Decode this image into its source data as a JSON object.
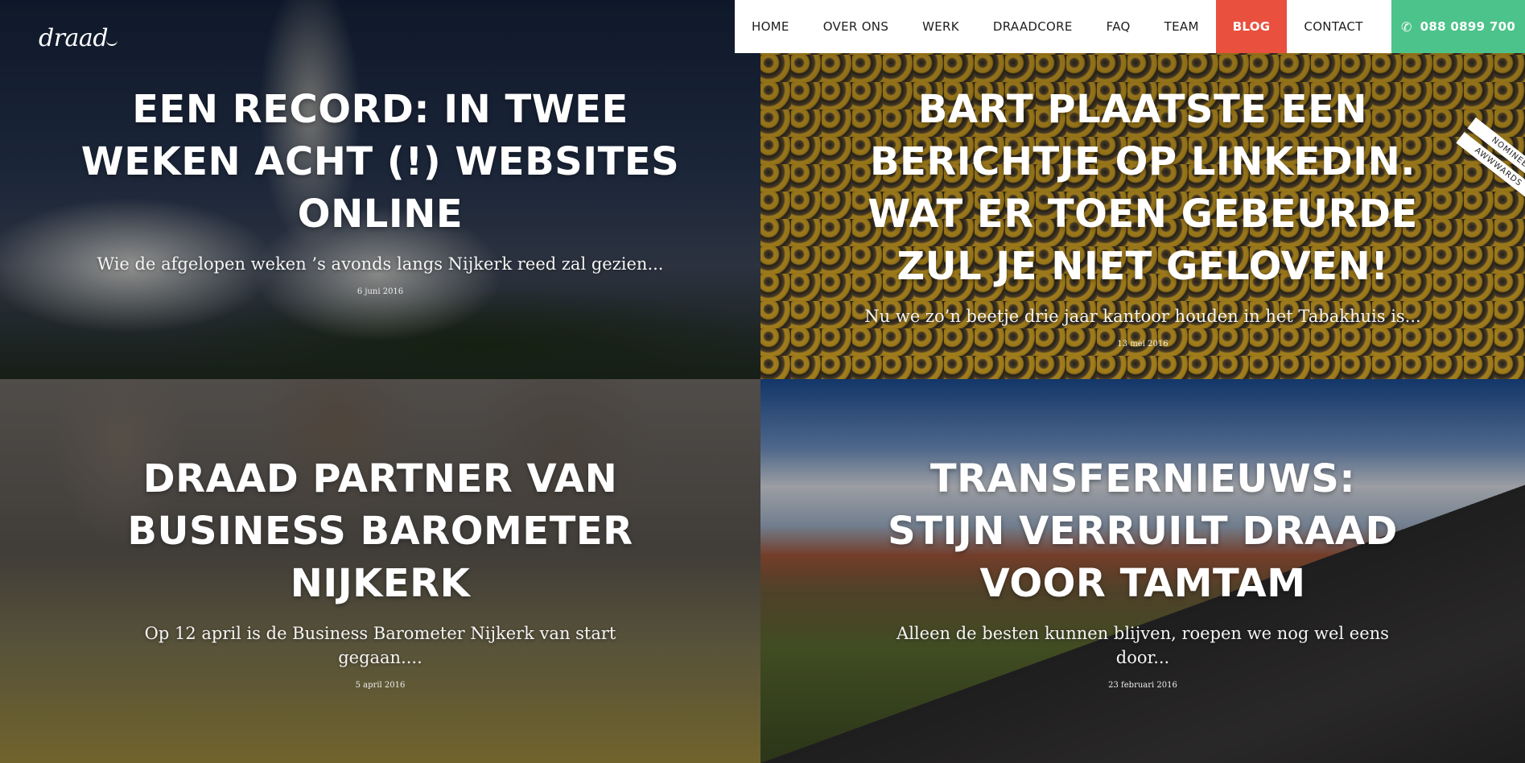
{
  "header": {
    "logo_text": "draad"
  },
  "nav": {
    "items": [
      {
        "label": "HOME"
      },
      {
        "label": "OVER ONS"
      },
      {
        "label": "WERK"
      },
      {
        "label": "DRAADCORE"
      },
      {
        "label": "FAQ"
      },
      {
        "label": "TEAM"
      },
      {
        "label": "BLOG",
        "active": true
      },
      {
        "label": "CONTACT"
      }
    ],
    "phone": {
      "icon": "phone-icon",
      "label": "088 0899 700"
    },
    "colors": {
      "active": "#e9503e",
      "phone": "#4cc38a"
    }
  },
  "ribbon": {
    "top": "NOMINEE",
    "bottom": "AWWWARDS"
  },
  "posts": [
    {
      "title": "EEN RECORD: IN TWEE WEKEN ACHT (!) WEBSITES ONLINE",
      "excerpt": "Wie de afgelopen weken ’s avonds langs Nijkerk reed zal gezien...",
      "date": "6 juni 2016"
    },
    {
      "title": "BART PLAATSTE EEN BERICHTJE OP LINKEDIN. WAT ER TOEN GEBEURDE ZUL JE NIET GELOVEN!",
      "excerpt": "Nu we zo’n beetje drie jaar kantoor houden in het Tabakhuis is...",
      "date": "13 mei 2016"
    },
    {
      "title": "DRAAD PARTNER VAN BUSINESS BAROMETER NIJKERK",
      "excerpt": "Op 12 april is de Business Barometer Nijkerk van start gegaan....",
      "date": "5 april 2016"
    },
    {
      "title": "TRANSFERNIEUWS: STIJN VERRUILT DRAAD VOOR TAMTAM",
      "excerpt": "Alleen de besten kunnen blijven, roepen we nog wel eens door...",
      "date": "23 februari 2016"
    }
  ]
}
